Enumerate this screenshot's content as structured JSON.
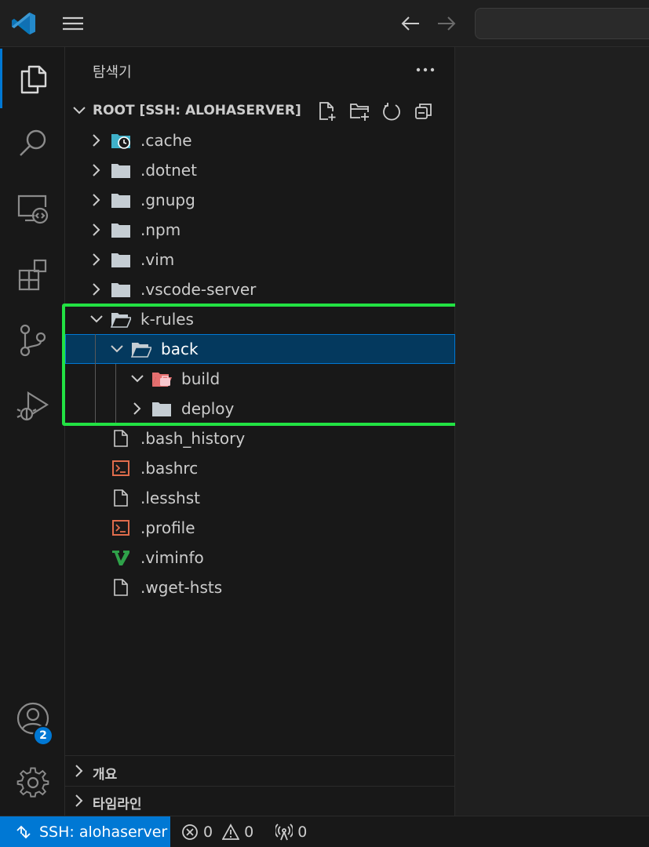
{
  "titlebar": {
    "logo_icon": "vscode-logo",
    "menu_icon": "hamburger-menu-icon",
    "back_icon": "arrow-left-icon",
    "forward_icon": "arrow-right-icon"
  },
  "activitybar": {
    "items": [
      {
        "name": "explorer",
        "icon": "files-icon",
        "active": true
      },
      {
        "name": "search",
        "icon": "search-icon"
      },
      {
        "name": "remote-explorer",
        "icon": "remote-explorer-icon"
      },
      {
        "name": "extensions",
        "icon": "extensions-icon"
      },
      {
        "name": "source-control",
        "icon": "source-control-icon"
      },
      {
        "name": "run-debug",
        "icon": "run-debug-icon"
      }
    ],
    "accounts_badge": "2",
    "accounts_icon": "account-icon",
    "manage_icon": "gear-icon"
  },
  "sidebar": {
    "title": "탐색기",
    "more_icon": "ellipsis-icon",
    "root_label": "ROOT [SSH: ALOHASERVER]",
    "header_actions": [
      "new-file-icon",
      "new-folder-icon",
      "refresh-icon",
      "collapse-all-icon"
    ],
    "tree": [
      {
        "name": ".cache",
        "type": "folder",
        "icon": "folder-cache-icon",
        "expanded": false,
        "depth": 0
      },
      {
        "name": ".dotnet",
        "type": "folder",
        "expanded": false,
        "depth": 0
      },
      {
        "name": ".gnupg",
        "type": "folder",
        "expanded": false,
        "depth": 0
      },
      {
        "name": ".npm",
        "type": "folder",
        "expanded": false,
        "depth": 0
      },
      {
        "name": ".vim",
        "type": "folder",
        "expanded": false,
        "depth": 0
      },
      {
        "name": ".vscode-server",
        "type": "folder",
        "expanded": false,
        "depth": 0
      },
      {
        "name": "k-rules",
        "type": "folder",
        "expanded": true,
        "depth": 0
      },
      {
        "name": "back",
        "type": "folder",
        "expanded": true,
        "depth": 1,
        "selected": true
      },
      {
        "name": "build",
        "type": "folder",
        "icon": "folder-build-icon",
        "expanded": true,
        "depth": 2
      },
      {
        "name": "deploy",
        "type": "folder",
        "expanded": false,
        "depth": 2
      },
      {
        "name": ".bash_history",
        "type": "file",
        "icon": "file-icon",
        "depth": 0
      },
      {
        "name": ".bashrc",
        "type": "file",
        "icon": "terminal-file-icon",
        "depth": 0
      },
      {
        "name": ".lesshst",
        "type": "file",
        "icon": "file-icon",
        "depth": 0
      },
      {
        "name": ".profile",
        "type": "file",
        "icon": "terminal-file-icon",
        "depth": 0
      },
      {
        "name": ".viminfo",
        "type": "file",
        "icon": "vim-icon",
        "depth": 0
      },
      {
        "name": ".wget-hsts",
        "type": "file",
        "icon": "file-icon",
        "depth": 0
      }
    ],
    "outline_label": "개요",
    "timeline_label": "타임라인"
  },
  "statusbar": {
    "remote_label": "SSH: alohaserver",
    "errors": "0",
    "warnings": "0",
    "ports": "0"
  },
  "colors": {
    "accent": "#0078d4",
    "selection": "#04395e",
    "highlight_box": "#22e243",
    "folder": "#c5cdd3"
  }
}
